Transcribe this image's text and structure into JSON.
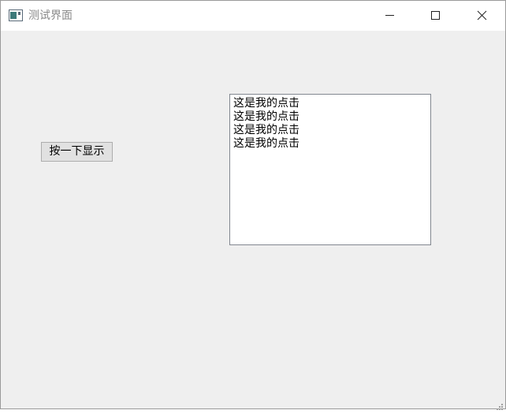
{
  "window": {
    "title": "测试界面",
    "icon": "app-window-icon",
    "controls": {
      "minimize": "minimize-icon",
      "maximize": "maximize-icon",
      "close": "close-icon"
    }
  },
  "main": {
    "button_label": "按一下显示",
    "text_box_lines": [
      "这是我的点击",
      "这是我的点击",
      "这是我的点击",
      "这是我的点击"
    ]
  },
  "colors": {
    "client_background": "#efefef",
    "title_text": "#8a8a8a",
    "button_background": "#e1e1e1",
    "text_box_border": "#828790"
  }
}
